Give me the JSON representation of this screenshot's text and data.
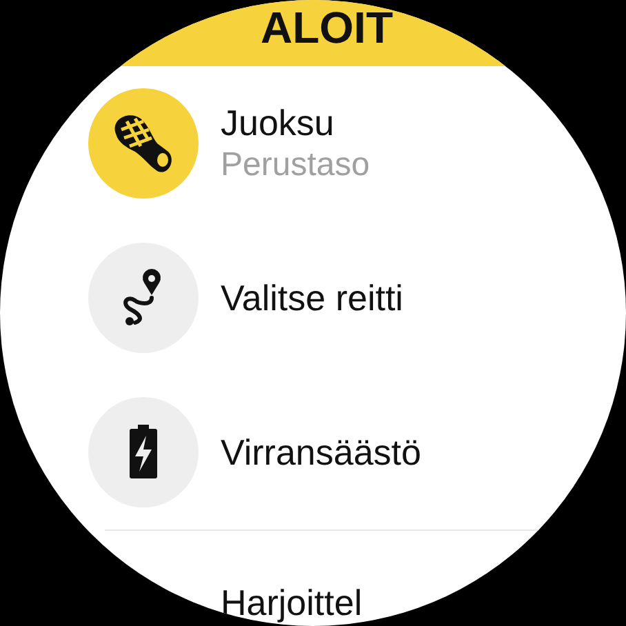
{
  "start_button": {
    "label": "ALOIT"
  },
  "items": [
    {
      "kind": "sport",
      "title": "Juoksu",
      "subtitle": "Perustaso"
    },
    {
      "kind": "route",
      "title": "Valitse reitti"
    },
    {
      "kind": "battery",
      "title": "Virransäästö"
    },
    {
      "kind": "plain",
      "title": "Harjoittel"
    }
  ]
}
